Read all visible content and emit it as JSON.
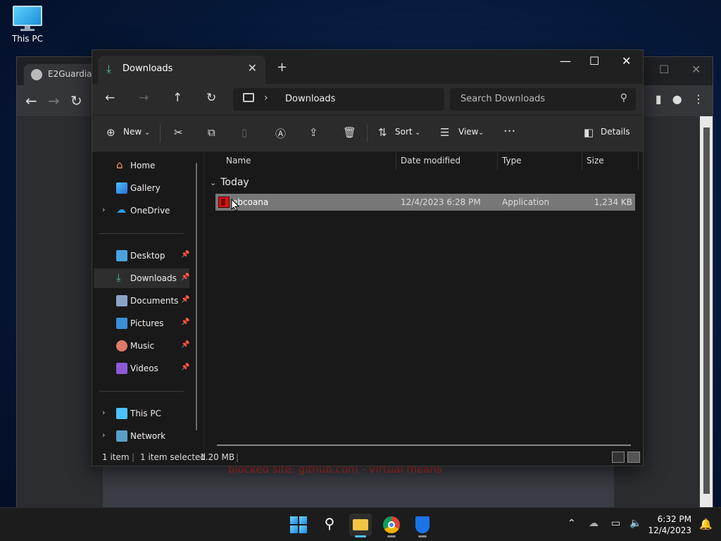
{
  "desktop": {
    "this_pc_label": "This PC"
  },
  "browser": {
    "tab_title": "E2Guardian",
    "page_red_text": "blocked site: github.com - Virtual means"
  },
  "explorer": {
    "tab_title": "Downloads",
    "breadcrumb": "Downloads",
    "search_placeholder": "Search Downloads",
    "toolbar": {
      "new_label": "New",
      "sort_label": "Sort",
      "view_label": "View",
      "details_label": "Details"
    },
    "nav": {
      "home": "Home",
      "gallery": "Gallery",
      "onedrive": "OneDrive",
      "desktop": "Desktop",
      "downloads": "Downloads",
      "documents": "Documents",
      "pictures": "Pictures",
      "music": "Music",
      "videos": "Videos",
      "this_pc": "This PC",
      "network": "Network"
    },
    "columns": {
      "name": "Name",
      "date_modified": "Date modified",
      "type": "Type",
      "size": "Size"
    },
    "group_label": "Today",
    "files": [
      {
        "name": "ebcoana",
        "date_modified": "12/4/2023 6:28 PM",
        "type": "Application",
        "size": "1,234 KB"
      }
    ],
    "status": {
      "item_count": "1 item",
      "selection": "1 item selected",
      "selection_size": "1.20 MB"
    }
  },
  "taskbar": {
    "time": "6:32 PM",
    "date": "12/4/2023",
    "accent": "#4cc2ff"
  }
}
